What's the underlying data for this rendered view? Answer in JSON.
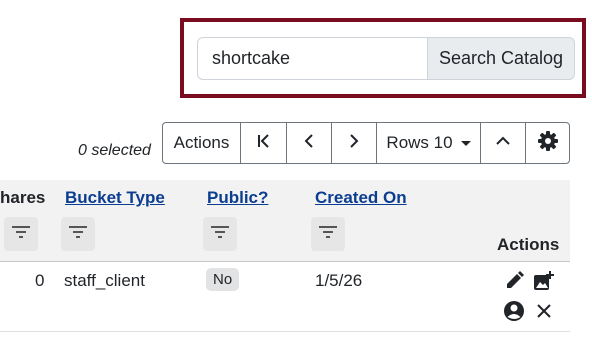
{
  "search": {
    "value": "shortcake",
    "button_label": "Search Catalog"
  },
  "toolbar": {
    "selected_text": "0 selected",
    "actions_label": "Actions",
    "rows_label": "Rows 10",
    "first_page_icon": "first-page-icon",
    "prev_icon": "chevron-left-icon",
    "next_icon": "chevron-right-icon",
    "collapse_icon": "chevron-up-icon",
    "settings_icon": "gear-icon"
  },
  "table": {
    "columns": [
      {
        "label": "hares",
        "link": false
      },
      {
        "label": "Bucket Type",
        "link": true
      },
      {
        "label": "Public?",
        "link": true
      },
      {
        "label": "Created On",
        "link": true
      },
      {
        "label": "Actions",
        "link": false
      }
    ],
    "rows": [
      {
        "shares": "0",
        "bucket_type": "staff_client",
        "public": "No",
        "created_on": "1/5/26",
        "actions": [
          "edit-icon",
          "add-image-icon",
          "user-icon",
          "close-icon"
        ]
      }
    ]
  },
  "colors": {
    "highlight": "#7a0c1f",
    "link": "#0b3d91",
    "header_bg": "#f2f2f2"
  }
}
